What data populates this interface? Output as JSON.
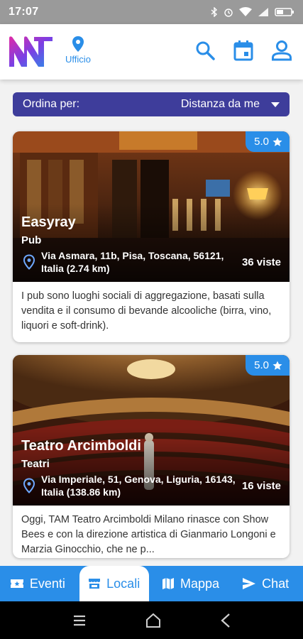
{
  "status_bar": {
    "time": "17:07"
  },
  "header": {
    "location_label": "Ufficio"
  },
  "sort": {
    "label": "Ordina per:",
    "value": "Distanza da me"
  },
  "venues": [
    {
      "rating": "5.0",
      "name": "Easyray",
      "category": "Pub",
      "address": "Via Asmara, 11b, Pisa, Toscana, 56121, Italia (2.74 km)",
      "views": "36 viste",
      "description": "I pub sono luoghi sociali di aggregazione, basati sulla vendita e il consumo di bevande alcooliche (birra, vino, liquori e soft-drink)."
    },
    {
      "rating": "5.0",
      "name": "Teatro Arcimboldi",
      "category": "Teatri",
      "address": "Via Imperiale, 51, Genova, Liguria, 16143, Italia (138.86 km)",
      "views": "16 viste",
      "description": "Oggi, TAM Teatro Arcimboldi Milano rinasce con Show Bees e con la direzione artistica di Gianmario Longoni e Marzia Ginocchio, che ne p..."
    }
  ],
  "bottom_nav": [
    {
      "label": "Eventi",
      "icon": "ticket-icon"
    },
    {
      "label": "Locali",
      "icon": "store-icon"
    },
    {
      "label": "Mappa",
      "icon": "map-icon"
    },
    {
      "label": "Chat",
      "icon": "send-icon"
    }
  ],
  "colors": {
    "accent": "#2a8ee8",
    "sort_bar": "#3e3d9b"
  }
}
